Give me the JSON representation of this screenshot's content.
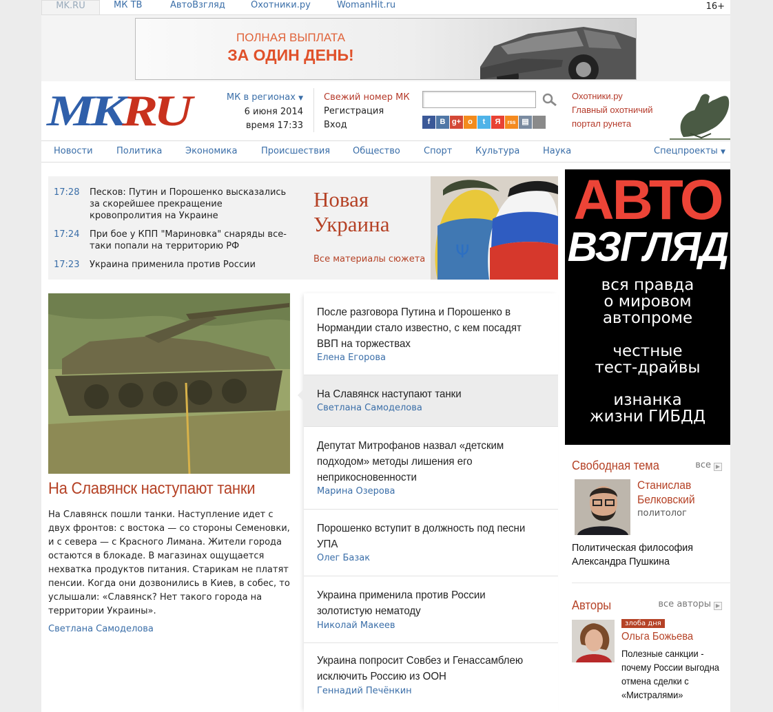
{
  "top_tabs": [
    "MK.RU",
    "МК ТВ",
    "АвтоВзгляд",
    "Охотники.ру",
    "WomanHit.ru"
  ],
  "age_badge": "16+",
  "banner": {
    "line1": "ПОЛНАЯ ВЫПЛАТА",
    "line2": "ЗА ОДИН ДЕНЬ!"
  },
  "logo": {
    "mk": "MK",
    "ru": "RU"
  },
  "header": {
    "regions": "МК в регионах",
    "date": "6 июня 2014",
    "time": "время 17:33",
    "fresh_issue": "Свежий номер МК",
    "register": "Регистрация",
    "login": "Вход",
    "socials": [
      {
        "label": "f",
        "color": "#3b5998"
      },
      {
        "label": "В",
        "color": "#5077a6"
      },
      {
        "label": "g+",
        "color": "#d34836"
      },
      {
        "label": "о",
        "color": "#f38b1d"
      },
      {
        "label": "t",
        "color": "#4fb3e8"
      },
      {
        "label": "Я",
        "color": "#e84234"
      },
      {
        "label": "rss",
        "color": "#f48a1f"
      },
      {
        "label": "▤",
        "color": "#7a8ba0"
      },
      {
        "label": "",
        "color": "#8a8a8a"
      }
    ]
  },
  "hunt": {
    "line1": "Охотники.ру",
    "line2": "Главный охотничий",
    "line3": "портал рунета"
  },
  "nav": {
    "items": [
      "Новости",
      "Политика",
      "Экономика",
      "Происшествия",
      "Общество",
      "Спорт",
      "Культура",
      "Наука"
    ],
    "special": "Спецпроекты"
  },
  "story": {
    "news": [
      {
        "time": "17:28",
        "text": "Песков: Путин и Порошенко высказались за скорейшее прекращение кровопролития на Украине"
      },
      {
        "time": "17:24",
        "text": "При бое у КПП \"Мариновка\" снаряды все-таки попали на территорию РФ"
      },
      {
        "time": "17:23",
        "text": "Украина применила против России"
      }
    ],
    "title": "Новая Украина",
    "all": "Все материалы сюжета"
  },
  "main": {
    "title": "На Славянск наступают танки",
    "text": "На Славянск пошли танки. Наступление идет с двух фронтов: с востока — со стороны Семеновки, и с севера — с Красного Лимана. Жители города остаются в блокаде. В магазинах ощущается нехватка продуктов питания. Старикам не платят пенсии. Когда они дозвонились в Киев, в собес, то услышали: «Славянск? Нет такого города на территории Украины».",
    "author": "Светлана Самоделова"
  },
  "feed": [
    {
      "headline": "После разговора Путина и Порошенко в Нормандии стало известно, с кем посадят ВВП на торжествах",
      "author": "Елена Егорова"
    },
    {
      "headline": "На Славянск наступают танки",
      "author": "Светлана Самоделова"
    },
    {
      "headline": "Депутат Митрофанов назвал «детским подходом» методы лишения его неприкосновенности",
      "author": "Марина Озерова"
    },
    {
      "headline": "Порошенко вступит в должность под песни УПА",
      "author": "Олег Базак"
    },
    {
      "headline": "Украина применила против России золотистую нематоду",
      "author": "Николай Макеев"
    },
    {
      "headline": "Украина попросит Совбез и Генассамблею исключить Россию из ООН",
      "author": "Геннадий Печёнкин"
    }
  ],
  "ad": {
    "line1": "АВТО",
    "line2": "ВЗГЛЯД",
    "sub1": [
      "вся правда",
      "о мировом",
      "автопроме"
    ],
    "sub2": [
      "честные",
      "тест-драйвы"
    ],
    "sub3": [
      "изнанка",
      "жизни ГИБДД"
    ]
  },
  "free_topic": {
    "heading": "Свободная тема",
    "all": "все",
    "name_first": "Станислав",
    "name_last": "Белковский",
    "role": "политолог",
    "topic": "Политическая философия Александра Пушкина"
  },
  "authors": {
    "heading": "Авторы",
    "all": "все авторы",
    "badge": "злоба дня",
    "name": "Ольга Божьева",
    "text": "Полезные санкции - почему России выгодна отмена сделки с «Мистралями»"
  }
}
